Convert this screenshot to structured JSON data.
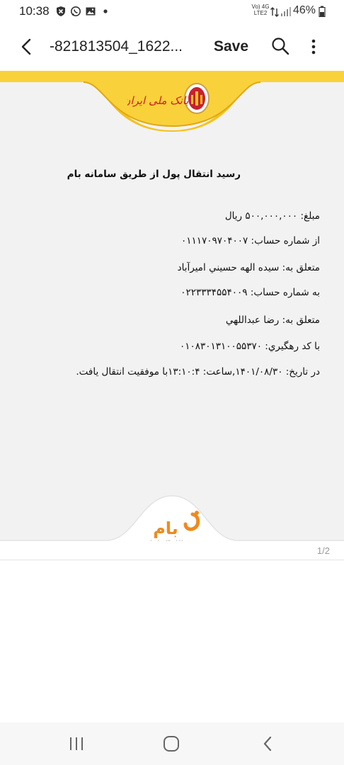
{
  "status_bar": {
    "time": "10:38",
    "network": "Vo) 4G LTE2",
    "battery": "46%"
  },
  "app_bar": {
    "title": "-821813504_1622...",
    "save_label": "Save"
  },
  "receipt": {
    "title": "رسید انتقال پول از طریق سامانه بام",
    "lines": [
      "مبلغ: ۵۰۰,۰۰۰,۰۰۰ ریال",
      "از شماره حساب: ۰۱۱۱۷۰۹۷۰۴۰۰۷",
      "متعلق به: سيده الهه حسيني اميرآباد",
      "به شماره حساب: ۰۲۲۳۳۳۴۵۵۴۰۰۹",
      "متعلق به: رضا عبداللهي",
      "با کد رهگيري: ۰۱۰۸۳۰۱۳۱۰۰۵۵۳۷۰",
      "در تاریخ: ۱۴۰۱/۰۸/۳۰,ساعت: ۱۳:۱۰:۴با موفقیت انتقال یافت."
    ]
  },
  "bank_logo_text": "بانک ملی ایران",
  "bam_logo_text": "بام",
  "bam_tagline": "بانکداری الکترونیکی ملی",
  "page_indicator": "1/2",
  "colors": {
    "accent_yellow": "#f6c21a",
    "bank_red": "#c8202f",
    "bam_orange": "#f08a1c"
  }
}
